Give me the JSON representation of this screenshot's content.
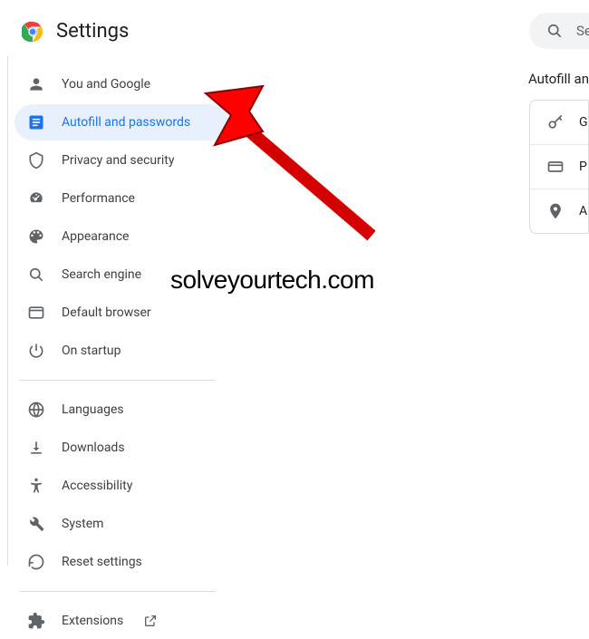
{
  "header": {
    "title": "Settings"
  },
  "search": {
    "placeholder": "Sea"
  },
  "sidebar": {
    "group1": [
      {
        "label": "You and Google",
        "icon": "person"
      },
      {
        "label": "Autofill and passwords",
        "icon": "autofill",
        "active": true
      },
      {
        "label": "Privacy and security",
        "icon": "shield"
      },
      {
        "label": "Performance",
        "icon": "speed"
      },
      {
        "label": "Appearance",
        "icon": "palette"
      },
      {
        "label": "Search engine",
        "icon": "search"
      },
      {
        "label": "Default browser",
        "icon": "browser"
      },
      {
        "label": "On startup",
        "icon": "power"
      }
    ],
    "group2": [
      {
        "label": "Languages",
        "icon": "globe"
      },
      {
        "label": "Downloads",
        "icon": "download"
      },
      {
        "label": "Accessibility",
        "icon": "accessibility"
      },
      {
        "label": "System",
        "icon": "wrench"
      },
      {
        "label": "Reset settings",
        "icon": "reset"
      }
    ],
    "group3": [
      {
        "label": "Extensions",
        "icon": "puzzle",
        "external": true
      }
    ]
  },
  "main": {
    "sectionTitle": "Autofill an",
    "rows": [
      {
        "label": "G",
        "icon": "key"
      },
      {
        "label": "P",
        "icon": "card"
      },
      {
        "label": "A",
        "icon": "pin"
      }
    ]
  },
  "watermark": "solveyourtech.com"
}
